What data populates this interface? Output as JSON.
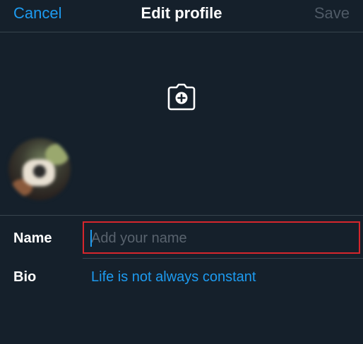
{
  "header": {
    "cancel_label": "Cancel",
    "title": "Edit profile",
    "save_label": "Save"
  },
  "banner": {
    "camera_icon": "camera-plus-icon"
  },
  "avatar": {
    "description_icon": "avatar"
  },
  "fields": {
    "name": {
      "label": "Name",
      "value": "",
      "placeholder": "Add your name"
    },
    "bio": {
      "label": "Bio",
      "value": "Life is not always constant"
    }
  },
  "colors": {
    "background": "#15202b",
    "accent": "#1d9bf0",
    "save_disabled": "#4f5a66",
    "divider": "#38444d",
    "highlight": "#d6262c"
  }
}
